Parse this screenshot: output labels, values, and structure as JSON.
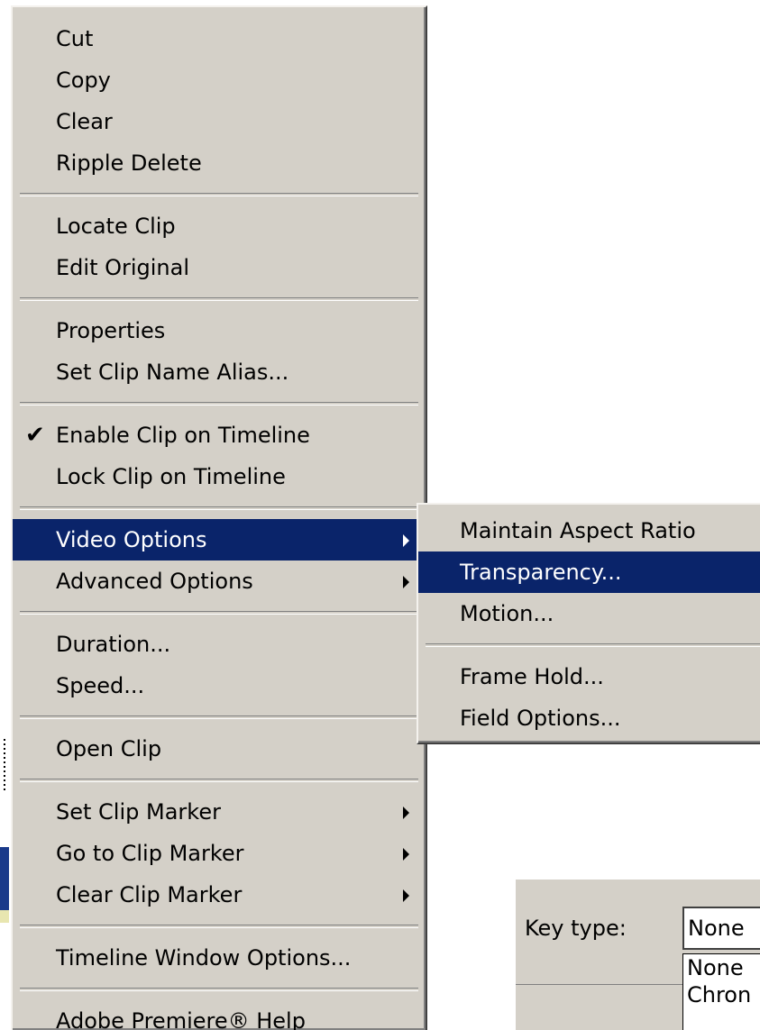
{
  "main_menu": {
    "groups": [
      [
        {
          "label": "Cut"
        },
        {
          "label": "Copy"
        },
        {
          "label": "Clear"
        },
        {
          "label": "Ripple Delete"
        }
      ],
      [
        {
          "label": "Locate Clip"
        },
        {
          "label": "Edit Original"
        }
      ],
      [
        {
          "label": "Properties"
        },
        {
          "label": "Set Clip Name Alias..."
        }
      ],
      [
        {
          "label": "Enable Clip on Timeline",
          "checked": true
        },
        {
          "label": "Lock Clip on Timeline"
        }
      ],
      [
        {
          "label": "Video Options",
          "submenu": true,
          "highlighted": true
        },
        {
          "label": "Advanced Options",
          "submenu": true
        }
      ],
      [
        {
          "label": "Duration..."
        },
        {
          "label": "Speed..."
        }
      ],
      [
        {
          "label": "Open Clip"
        }
      ],
      [
        {
          "label": "Set Clip Marker",
          "submenu": true
        },
        {
          "label": "Go to Clip Marker",
          "submenu": true
        },
        {
          "label": "Clear Clip Marker",
          "submenu": true
        }
      ],
      [
        {
          "label": "Timeline Window Options..."
        }
      ],
      [
        {
          "label": "Adobe Premiere® Help"
        }
      ]
    ]
  },
  "video_options_submenu": {
    "groups": [
      [
        {
          "label": "Maintain Aspect Ratio"
        },
        {
          "label": "Transparency...",
          "highlighted": true
        },
        {
          "label": "Motion..."
        }
      ],
      [
        {
          "label": "Frame Hold..."
        },
        {
          "label": "Field Options..."
        }
      ]
    ]
  },
  "dialog": {
    "key_type_label": "Key type:",
    "key_type_value": "None",
    "key_type_options": [
      "None",
      "Chron"
    ]
  },
  "colors": {
    "menu_bg": "#d4d0c8",
    "highlight_bg": "#0a246a",
    "highlight_text": "#ffffff"
  }
}
